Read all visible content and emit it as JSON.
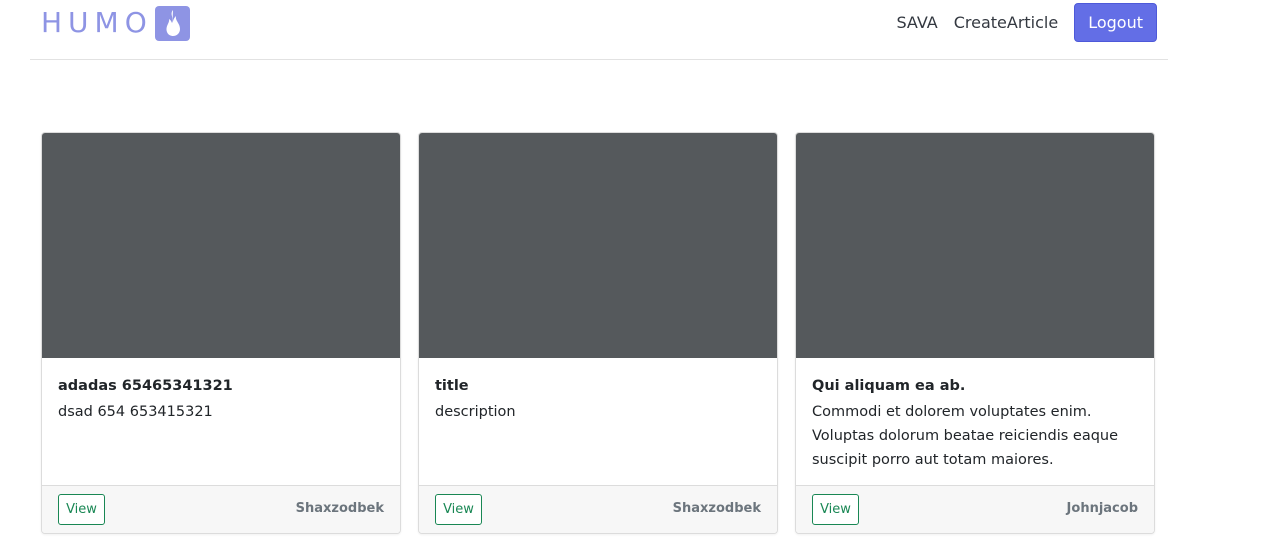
{
  "navbar": {
    "brand_text": "HUMO",
    "brand_logo_icon": "flame-icon",
    "brand_color": "#8e94e4",
    "links": [
      "SAVA",
      "CreateArticle"
    ],
    "logout_label": "Logout",
    "logout_color": "#636ee6"
  },
  "cards": [
    {
      "title": "adadas 65465341321",
      "text": "dsad 654 653415321",
      "view_label": "View",
      "author": "Shaxzodbek"
    },
    {
      "title": "title",
      "text": "description",
      "view_label": "View",
      "author": "Shaxzodbek"
    },
    {
      "title": "Qui aliquam ea ab.",
      "text": "Commodi et dolorem voluptates enim. Voluptas dolorum beatae reiciendis eaque suscipit porro aut totam maiores.",
      "view_label": "View",
      "author": "Johnjacob"
    }
  ],
  "colors": {
    "image_placeholder": "#55595c",
    "view_button": "#198754"
  }
}
